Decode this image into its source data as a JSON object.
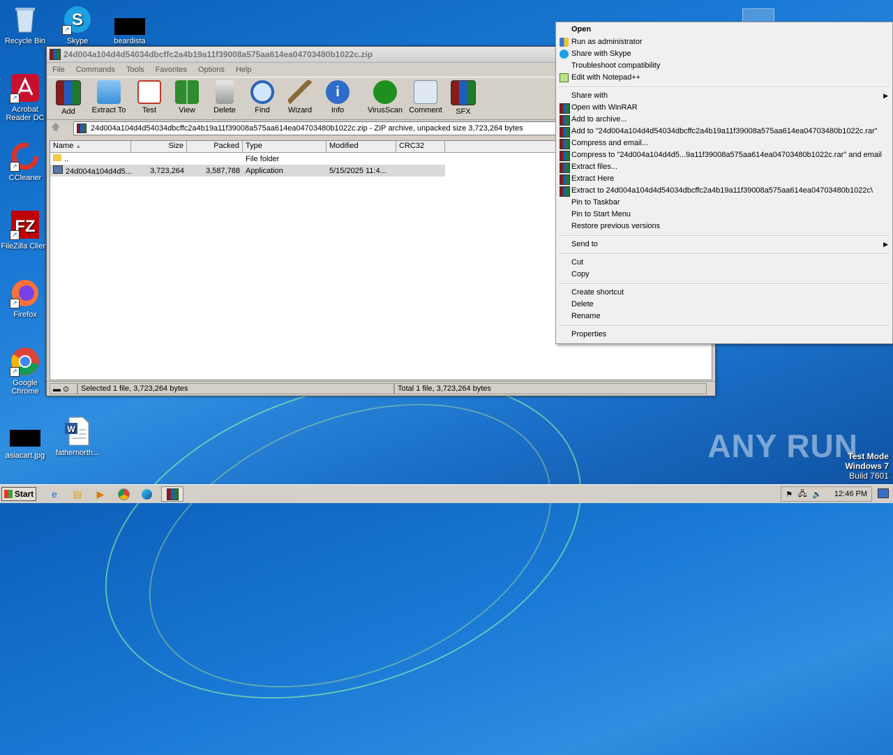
{
  "desktop": {
    "icons": [
      {
        "label": "Recycle Bin"
      },
      {
        "label": "Skype"
      },
      {
        "label": "beardista"
      },
      {
        "label": "Acrobat Reader DC"
      },
      {
        "label": "CCleaner"
      },
      {
        "label": "FileZilla Client"
      },
      {
        "label": "Firefox"
      },
      {
        "label": "Google Chrome"
      },
      {
        "label": "asiacart.jpg"
      },
      {
        "label": "fathernorth..."
      }
    ]
  },
  "winrar": {
    "title": "24d004a104d4d54034dbcffc2a4b19a11f39008a575aa614ea04703480b1022c.zip",
    "menu": [
      "File",
      "Commands",
      "Tools",
      "Favorites",
      "Options",
      "Help"
    ],
    "toolbar": [
      "Add",
      "Extract To",
      "Test",
      "View",
      "Delete",
      "Find",
      "Wizard",
      "Info",
      "VirusScan",
      "Comment",
      "SFX"
    ],
    "address": "24d004a104d4d54034dbcffc2a4b19a11f39008a575aa614ea04703480b1022c.zip - ZIP archive, unpacked size 3,723,264 bytes",
    "columns": [
      "Name",
      "Size",
      "Packed",
      "Type",
      "Modified",
      "CRC32"
    ],
    "rows": [
      {
        "name": "..",
        "size": "",
        "packed": "",
        "type": "File folder",
        "modified": ""
      },
      {
        "name": "24d004a104d4d5...",
        "size": "3,723,264",
        "packed": "3,587,788",
        "type": "Application",
        "modified": "5/15/2025 11:4..."
      }
    ],
    "status_left": "Selected 1 file, 3,723,264 bytes",
    "status_right": "Total 1 file, 3,723,264 bytes"
  },
  "context_menu": {
    "items": [
      "Open",
      "Run as administrator",
      "Share with Skype",
      "Troubleshoot compatibility",
      "Edit with Notepad++",
      "Share with",
      "Open with WinRAR",
      "Add to archive...",
      "Add to \"24d004a104d4d54034dbcffc2a4b19a11f39008a575aa614ea04703480b1022c.rar\"",
      "Compress and email...",
      "Compress to \"24d004a104d4d5...9a11f39008a575aa614ea04703480b1022c.rar\" and email",
      "Extract files...",
      "Extract Here",
      "Extract to 24d004a104d4d54034dbcffc2a4b19a11f39008a575aa614ea04703480b1022c\\",
      "Pin to Taskbar",
      "Pin to Start Menu",
      "Restore previous versions",
      "Send to",
      "Cut",
      "Copy",
      "Create shortcut",
      "Delete",
      "Rename",
      "Properties"
    ]
  },
  "taskbar": {
    "start_label": "Start",
    "clock": "12:46 PM"
  },
  "watermark": "ANY RUN",
  "test_mode": {
    "line1": "Test Mode",
    "line2": "Windows 7",
    "line3": "Build 7601"
  }
}
